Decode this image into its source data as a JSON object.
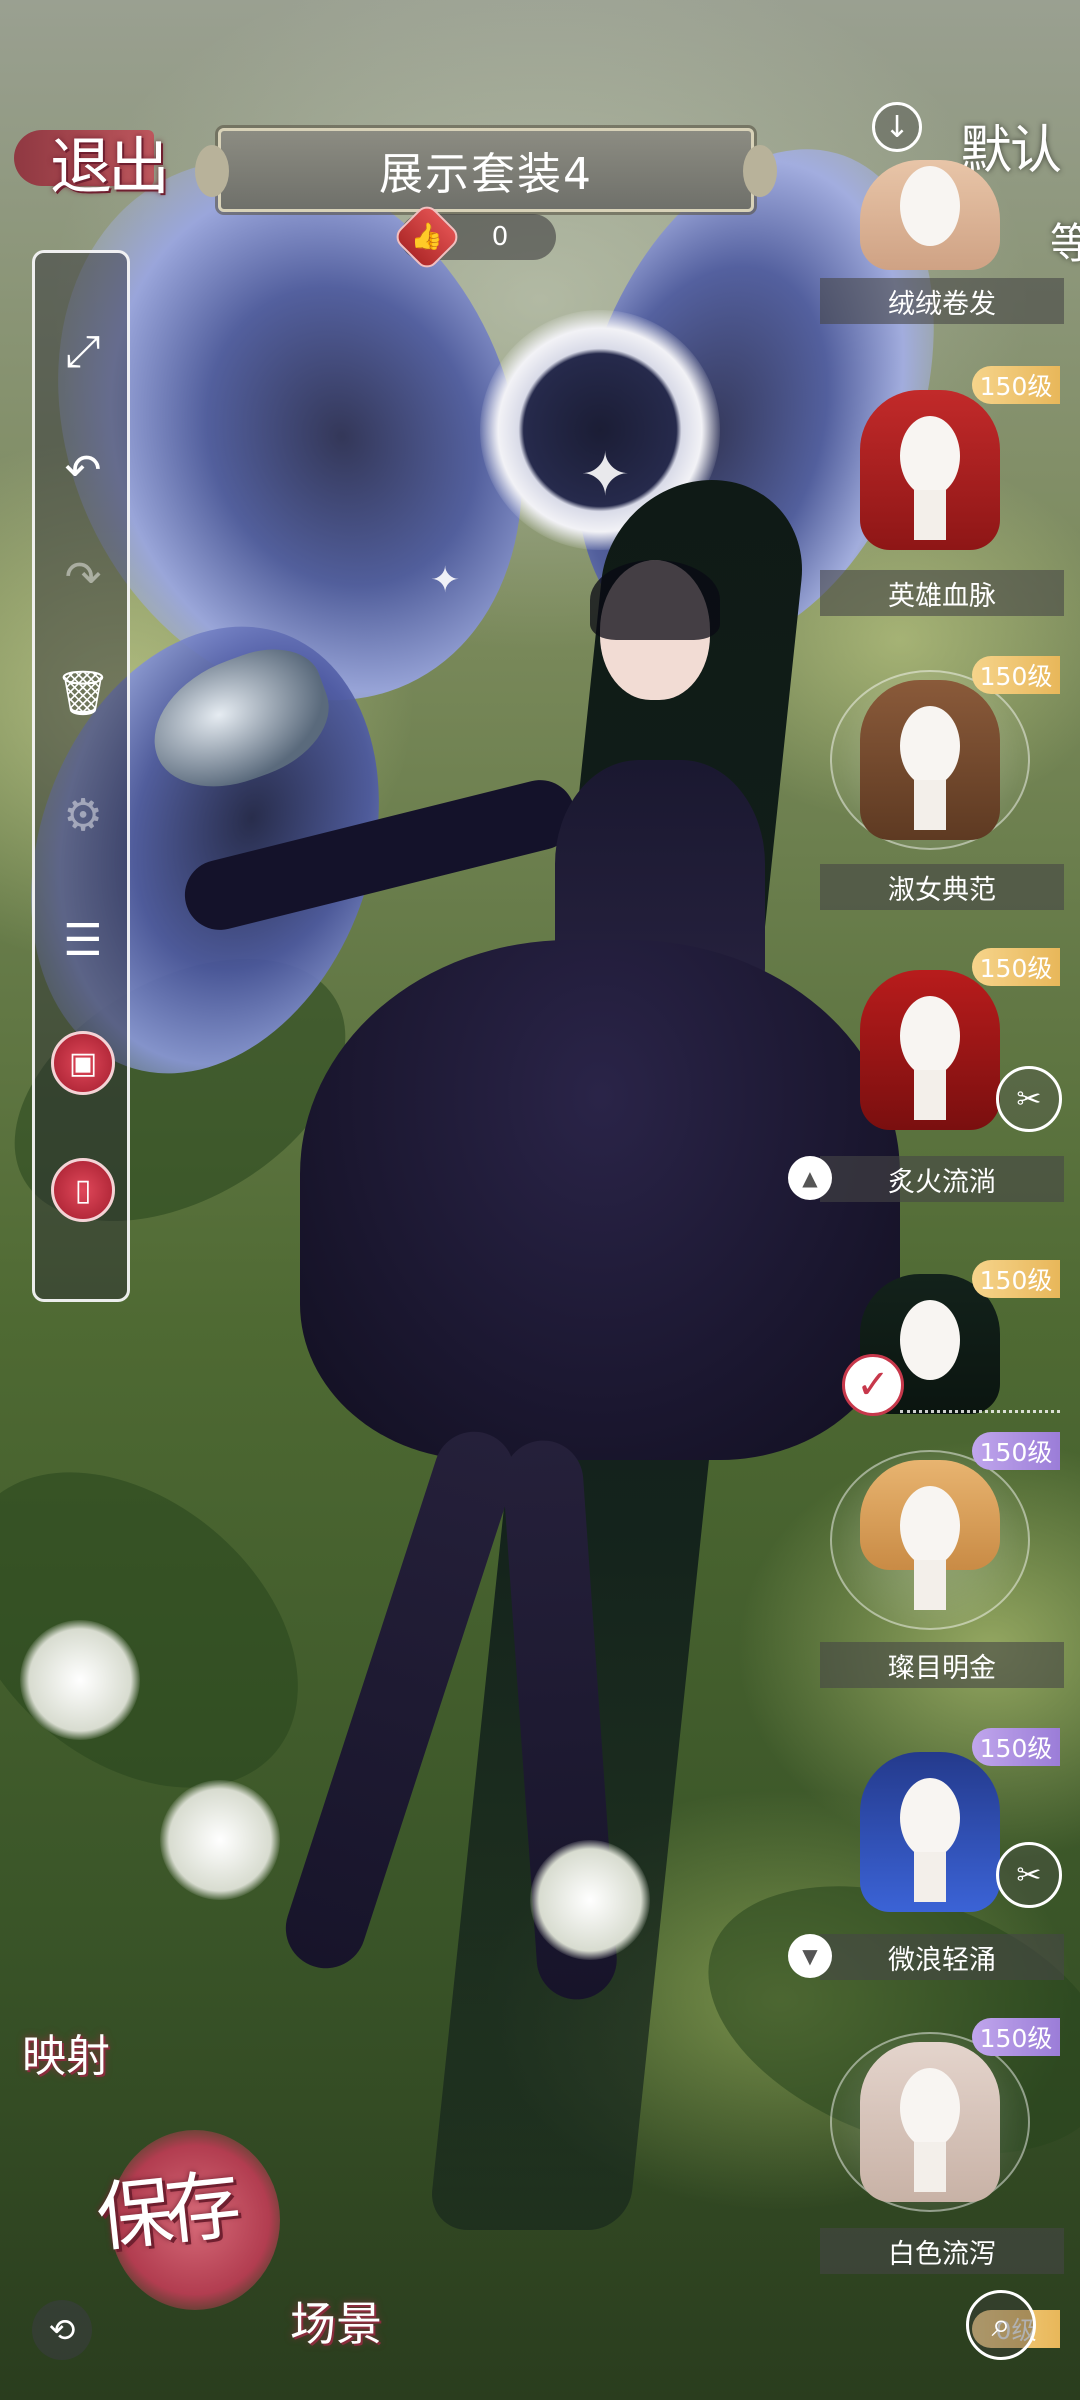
{
  "header": {
    "exit_label": "退出",
    "outfit_title": "展示套装4",
    "like_count": "0"
  },
  "toolbar": {
    "tools": [
      {
        "name": "fullscreen",
        "glyph": "⤢"
      },
      {
        "name": "undo",
        "glyph": "↶"
      },
      {
        "name": "redo",
        "glyph": "↷"
      },
      {
        "name": "delete",
        "glyph": "🗑"
      },
      {
        "name": "settings",
        "glyph": "⚙"
      },
      {
        "name": "list",
        "glyph": "☰"
      },
      {
        "name": "image",
        "glyph": "▣"
      },
      {
        "name": "phone",
        "glyph": "▯"
      }
    ]
  },
  "hair_panel": {
    "default_label": "默认",
    "edge_char": "等",
    "items": [
      {
        "name": "绒绒卷发",
        "level": ""
      },
      {
        "name": "英雄血脉",
        "level": "150级"
      },
      {
        "name": "淑女典范",
        "level": "150级"
      },
      {
        "name": "炙火流淌",
        "level": "150级"
      },
      {
        "name": "",
        "level": "150级"
      },
      {
        "name": "璨目明金",
        "level": "150级"
      },
      {
        "name": "微浪轻涌",
        "level": "150级"
      },
      {
        "name": "白色流泻",
        "level": "150级"
      },
      {
        "name": "",
        "level": "0级"
      }
    ]
  },
  "actions": {
    "mirror_label": "映射",
    "save_label": "保存",
    "scene_label": "场景"
  },
  "colors": {
    "accent_red": "#c7384b",
    "badge_gold": "#e8b75a",
    "badge_purple": "#9b7dd8"
  }
}
